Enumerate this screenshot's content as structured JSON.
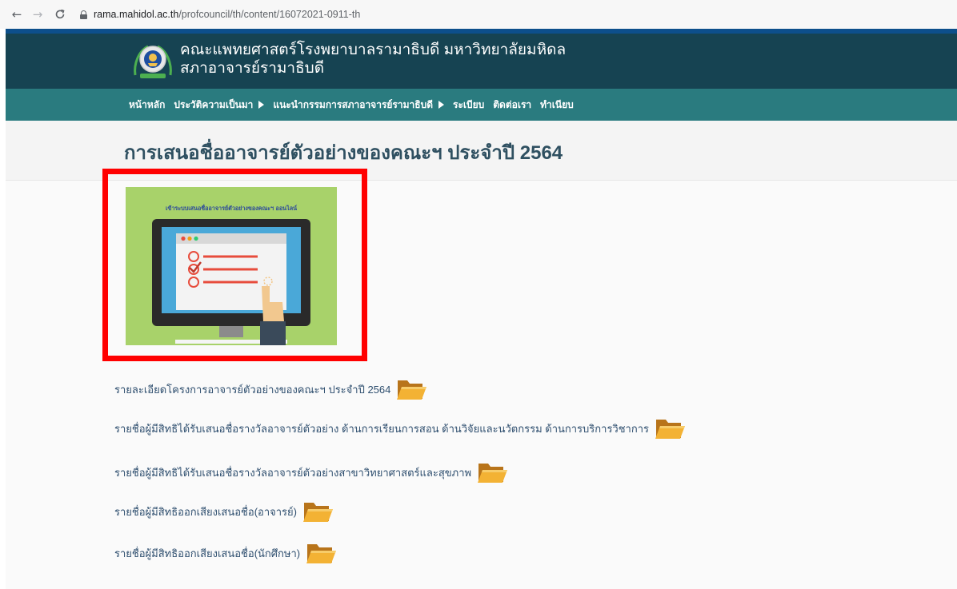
{
  "browser": {
    "back_icon": "←",
    "forward_icon": "→",
    "reload_icon": "C",
    "url_domain": "rama.mahidol.ac.th",
    "url_path": "/profcouncil/th/content/16072021-0911-th"
  },
  "header": {
    "title_line1": "คณะแพทยศาสตร์โรงพยาบาลรามาธิบดี มหาวิทยาลัยมหิดล",
    "title_line2": "สภาอาจารย์รามาธิบดี"
  },
  "nav": {
    "items": [
      {
        "label": "หน้าหลัก",
        "has_submenu": false
      },
      {
        "label": "ประวัติความเป็นมา",
        "has_submenu": true
      },
      {
        "label": "แนะนำกรรมการสภาอาจารย์รามาธิบดี",
        "has_submenu": true
      },
      {
        "label": "ระเบียบ",
        "has_submenu": false
      },
      {
        "label": "ติดต่อเรา",
        "has_submenu": false
      },
      {
        "label": "ทำเนียบ",
        "has_submenu": false
      }
    ]
  },
  "page": {
    "title": "การเสนอชื่ออาจารย์ตัวอย่างของคณะฯ ประจำปี 2564"
  },
  "banner_image": {
    "caption": "เข้าระบบเสนอชื่ออาจารย์ตัวอย่างของคณะฯ ออนไลน์"
  },
  "links": [
    {
      "label": "รายละเอียดโครงการอาจารย์ตัวอย่างของคณะฯ ประจำปี 2564"
    },
    {
      "label": "รายชื่อผู้มีสิทธิได้รับเสนอชื่อรางวัลอาจารย์ตัวอย่าง ด้านการเรียนการสอน ด้านวิจัยและนวัตกรรม ด้านการบริการวิชาการ"
    },
    {
      "label": "รายชื่อผู้มีสิทธิได้รับเสนอชื่อรางวัลอาจารย์ตัวอย่างสาขาวิทยาศาสตร์และสุขภาพ"
    },
    {
      "label": "รายชื่อผู้มีสิทธิออกเสียงเสนอชื่อ(อาจารย์)"
    },
    {
      "label": "รายชื่อผู้มีสิทธิออกเสียงเสนอชื่อ(นักศึกษา)"
    }
  ],
  "colors": {
    "accent_bar": "#0d4f8b",
    "banner_bg": "#164352",
    "navbar_bg": "#2a7b7f",
    "highlight_frame": "#ff0000",
    "image_bg": "#a8d26a"
  },
  "icons": {
    "folder": "folder-icon",
    "lock": "lock-icon",
    "logo": "faculty-logo"
  }
}
